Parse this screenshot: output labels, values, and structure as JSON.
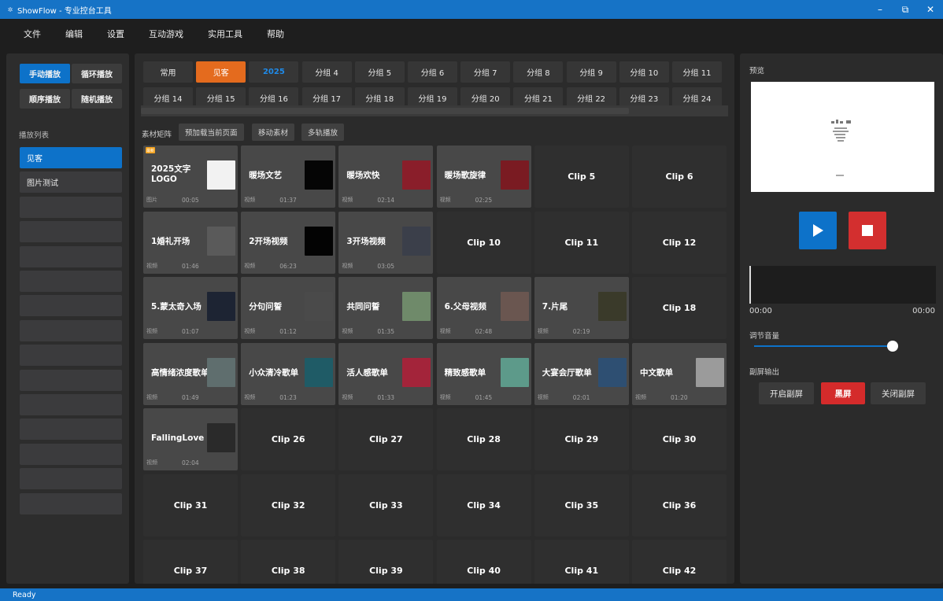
{
  "window": {
    "title": "ShowFlow - 专业控台工具",
    "minimize": "–",
    "maximize": "⧉",
    "close": "✕"
  },
  "menu": [
    "文件",
    "编辑",
    "设置",
    "互动游戏",
    "实用工具",
    "帮助"
  ],
  "modes": [
    "手动播放",
    "循环播放",
    "顺序播放",
    "随机播放"
  ],
  "playlist": {
    "title": "播放列表",
    "items": [
      "见客",
      "图片测试",
      "",
      "",
      "",
      "",
      "",
      "",
      "",
      "",
      "",
      "",
      "",
      "",
      ""
    ]
  },
  "tabs": {
    "row1": [
      "常用",
      "见客",
      "2025",
      "分组 4",
      "分组 5",
      "分组 6",
      "分组 7",
      "分组 8",
      "分组 9",
      "分组 10",
      "分组 11"
    ],
    "row2": [
      "分组 14",
      "分组 15",
      "分组 16",
      "分组 17",
      "分组 18",
      "分组 19",
      "分组 20",
      "分组 21",
      "分组 22",
      "分组 23",
      "分组 24"
    ]
  },
  "toolbar": {
    "label": "素材矩阵",
    "preload": "预加载当前页面",
    "move": "移动素材",
    "multitrack": "多轨播放"
  },
  "accent": {
    "blue": "#0d72c9",
    "orange": "#e46b1e",
    "red": "#d42b2b"
  },
  "clips": [
    {
      "name": "2025文字LOGO",
      "type": "图片",
      "duration": "00:05",
      "thumb": "#f2f2f2",
      "badge": "最新"
    },
    {
      "name": "暖场文艺",
      "type": "视频",
      "duration": "01:37",
      "thumb": "#050505"
    },
    {
      "name": "暖场欢快",
      "type": "视频",
      "duration": "02:14",
      "thumb": "#8a1e2a"
    },
    {
      "name": "暖场歌旋律",
      "type": "视频",
      "duration": "02:25",
      "thumb": "#7a1b22"
    },
    {
      "name": "Clip 5"
    },
    {
      "name": "Clip 6"
    },
    {
      "name": "1婚礼开场",
      "type": "视频",
      "duration": "01:46",
      "thumb": "#5a5a5a"
    },
    {
      "name": "2开场视频",
      "type": "视频",
      "duration": "06:23",
      "thumb": "#030303"
    },
    {
      "name": "3开场视频",
      "type": "视频",
      "duration": "03:05",
      "thumb": "#3b3f4a"
    },
    {
      "name": "Clip 10"
    },
    {
      "name": "Clip 11"
    },
    {
      "name": "Clip 12"
    },
    {
      "name": "5.蒙太奇入场",
      "type": "视频",
      "duration": "01:07",
      "thumb": "#1d2433"
    },
    {
      "name": "分句问誓",
      "type": "视频",
      "duration": "01:12",
      "thumb": "#4a4a4a"
    },
    {
      "name": "共同问誓",
      "type": "视频",
      "duration": "01:35",
      "thumb": "#6f8a6a"
    },
    {
      "name": "6.父母视频",
      "type": "视频",
      "duration": "02:48",
      "thumb": "#6a5650"
    },
    {
      "name": "7.片尾",
      "type": "视频",
      "duration": "02:19",
      "thumb": "#3a3a2a"
    },
    {
      "name": "Clip 18"
    },
    {
      "name": "高情绪浓度歌单",
      "type": "视频",
      "duration": "01:49",
      "thumb": "#5f6e6e"
    },
    {
      "name": "小众清冷歌单",
      "type": "视频",
      "duration": "01:23",
      "thumb": "#1f5b66"
    },
    {
      "name": "活人感歌单",
      "type": "视频",
      "duration": "01:33",
      "thumb": "#a3243a"
    },
    {
      "name": "精致感歌单",
      "type": "视频",
      "duration": "01:45",
      "thumb": "#5d9a8a"
    },
    {
      "name": "大宴会厅歌单",
      "type": "视频",
      "duration": "02:01",
      "thumb": "#2e4f72"
    },
    {
      "name": "中文歌单",
      "type": "视频",
      "duration": "01:20",
      "thumb": "#9b9b9b"
    },
    {
      "name": "FallingLove",
      "type": "视频",
      "duration": "02:04",
      "thumb": "#2a2a2a"
    },
    {
      "name": "Clip 26"
    },
    {
      "name": "Clip 27"
    },
    {
      "name": "Clip 28"
    },
    {
      "name": "Clip 29"
    },
    {
      "name": "Clip 30"
    },
    {
      "name": "Clip 31"
    },
    {
      "name": "Clip 32"
    },
    {
      "name": "Clip 33"
    },
    {
      "name": "Clip 34"
    },
    {
      "name": "Clip 35"
    },
    {
      "name": "Clip 36"
    },
    {
      "name": "Clip 37"
    },
    {
      "name": "Clip 38"
    },
    {
      "name": "Clip 39"
    },
    {
      "name": "Clip 40"
    },
    {
      "name": "Clip 41"
    },
    {
      "name": "Clip 42"
    }
  ],
  "preview": {
    "title": "预览"
  },
  "transport": {
    "play_icon": "play-icon",
    "stop_icon": "stop-icon",
    "time_current": "00:00",
    "time_total": "00:00"
  },
  "volume": {
    "label": "调节音量",
    "level": 0.9
  },
  "subscreen": {
    "label": "副屏输出",
    "open": "开启副屏",
    "black": "黑屏",
    "close": "关闭副屏"
  },
  "status": "Ready"
}
